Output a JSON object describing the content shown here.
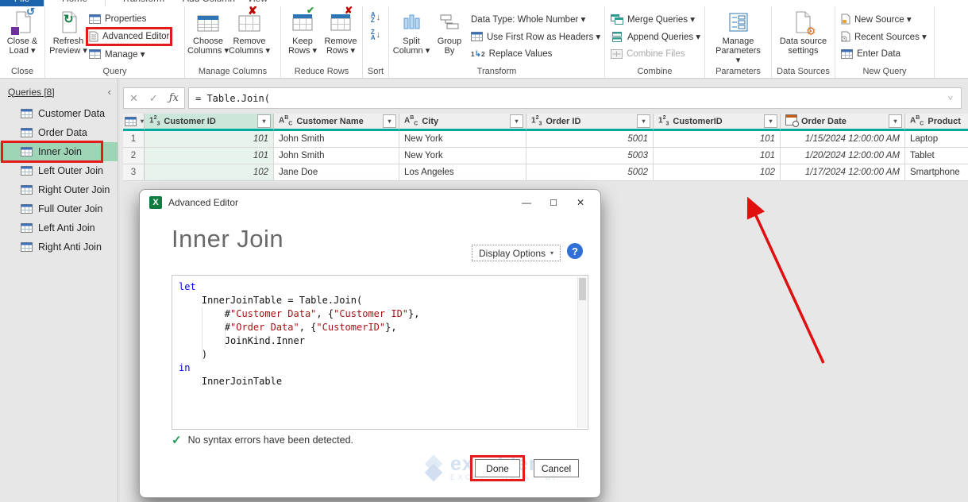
{
  "tabs": [
    {
      "label": "File",
      "file": true
    },
    {
      "label": "Home",
      "active": true
    },
    {
      "label": "Transform"
    },
    {
      "label": "Add Column"
    },
    {
      "label": "View"
    }
  ],
  "ribbon": {
    "close_label": "Close",
    "close_load": "Close & Load ▾",
    "query_label": "Query",
    "refresh": "Refresh Preview ▾",
    "properties": "Properties",
    "advanced_editor": "Advanced Editor",
    "manage": "Manage ▾",
    "manage_columns_label": "Manage Columns",
    "choose_columns": "Choose Columns ▾",
    "remove_columns": "Remove Columns ▾",
    "reduce_rows_label": "Reduce Rows",
    "keep_rows": "Keep Rows ▾",
    "remove_rows": "Remove Rows ▾",
    "sort_label": "Sort",
    "transform_label": "Transform",
    "split_column": "Split Column ▾",
    "group_by": "Group By",
    "data_type": "Data Type: Whole Number ▾",
    "first_row": "Use First Row as Headers ▾",
    "replace_values": "Replace Values",
    "combine_label": "Combine",
    "merge": "Merge Queries ▾",
    "append": "Append Queries ▾",
    "combine_files": "Combine Files",
    "parameters_label": "Parameters",
    "manage_parameters": "Manage Parameters ▾",
    "data_sources_label": "Data Sources",
    "data_source_settings": "Data source settings",
    "new_query_label": "New Query",
    "new_source": "New Source ▾",
    "recent_sources": "Recent Sources ▾",
    "enter_data": "Enter Data"
  },
  "sidebar": {
    "header": "Queries [8]",
    "items": [
      {
        "label": "Customer Data"
      },
      {
        "label": "Order Data"
      },
      {
        "label": "Inner Join",
        "selected": true,
        "annotated": true
      },
      {
        "label": "Left Outer Join"
      },
      {
        "label": "Right Outer Join"
      },
      {
        "label": "Full Outer Join"
      },
      {
        "label": "Left Anti Join"
      },
      {
        "label": "Right Anti Join"
      }
    ]
  },
  "formula_bar": {
    "formula": "= Table.Join("
  },
  "table": {
    "columns": [
      {
        "label": "Customer ID",
        "type": "number",
        "selected": true
      },
      {
        "label": "Customer Name",
        "type": "text"
      },
      {
        "label": "City",
        "type": "text"
      },
      {
        "label": "Order ID",
        "type": "number"
      },
      {
        "label": "CustomerID",
        "type": "number"
      },
      {
        "label": "Order Date",
        "type": "datetime"
      },
      {
        "label": "Product",
        "type": "text"
      }
    ],
    "rows": [
      [
        "101",
        "John Smith",
        "New York",
        "5001",
        "101",
        "1/15/2024 12:00:00 AM",
        "Laptop"
      ],
      [
        "101",
        "John Smith",
        "New York",
        "5003",
        "101",
        "1/20/2024 12:00:00 AM",
        "Tablet"
      ],
      [
        "102",
        "Jane Doe",
        "Los Angeles",
        "5002",
        "102",
        "1/17/2024 12:00:00 AM",
        "Smartphone"
      ]
    ]
  },
  "dialog": {
    "title": "Advanced Editor",
    "heading": "Inner Join",
    "display_options": "Display Options",
    "help": "?",
    "code_lines": [
      [
        {
          "c": "k",
          "t": "let"
        }
      ],
      [
        {
          "c": "p",
          "t": "    InnerJoinTable = Table.Join("
        }
      ],
      [
        {
          "c": "p",
          "t": "        #"
        },
        {
          "c": "s",
          "t": "\"Customer Data\""
        },
        {
          "c": "p",
          "t": ", {"
        },
        {
          "c": "s",
          "t": "\"Customer ID\""
        },
        {
          "c": "p",
          "t": "},"
        }
      ],
      [
        {
          "c": "p",
          "t": "        #"
        },
        {
          "c": "s",
          "t": "\"Order Data\""
        },
        {
          "c": "p",
          "t": ", {"
        },
        {
          "c": "s",
          "t": "\"CustomerID\""
        },
        {
          "c": "p",
          "t": "},"
        }
      ],
      [
        {
          "c": "p",
          "t": "        JoinKind.Inner"
        }
      ],
      [
        {
          "c": "p",
          "t": "    )"
        }
      ],
      [
        {
          "c": "k",
          "t": "in"
        }
      ],
      [
        {
          "c": "p",
          "t": "    InnerJoinTable"
        }
      ]
    ],
    "status": "No syntax errors have been detected.",
    "done": "Done",
    "cancel": "Cancel",
    "watermark": {
      "name": "exceldemy",
      "tagline": "EXCEL · DATA · BI"
    }
  },
  "colors": {
    "accent_teal": "#00A99D",
    "selection_green": "#9ED5B6",
    "annotation_red": "#E31B1B",
    "keyword_blue": "#0000E8",
    "string_red": "#A31515",
    "excel_green": "#107C41",
    "help_blue": "#2F6FD6"
  }
}
